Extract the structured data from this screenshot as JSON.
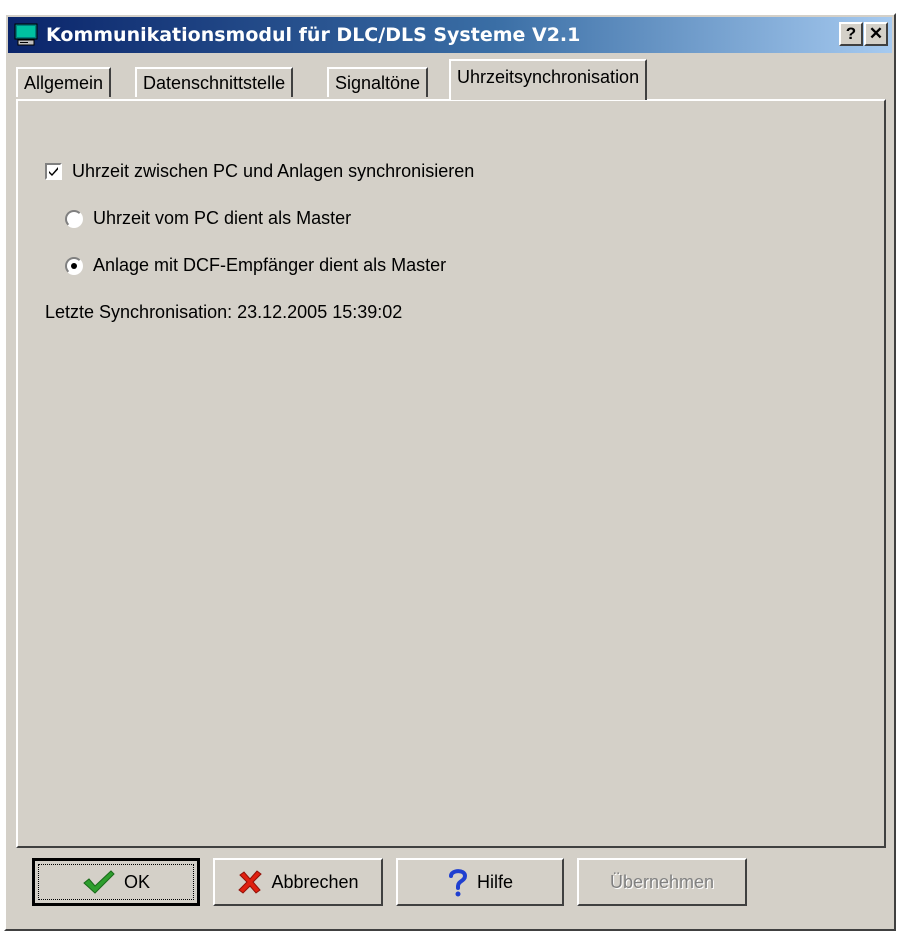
{
  "window": {
    "title": "Kommunikationsmodul für DLC/DLS Systeme V2.1",
    "help_label": "?",
    "close_label": "✕"
  },
  "tabs": [
    {
      "label": "Allgemein",
      "active": false
    },
    {
      "label": "Datenschnittstelle",
      "active": false
    },
    {
      "label": "Signaltöne",
      "active": false
    },
    {
      "label": "Uhrzeitsynchronisation",
      "active": true
    }
  ],
  "sync": {
    "checkbox_label": "Uhrzeit zwischen PC und Anlagen synchronisieren",
    "checkbox_checked": true,
    "radio_pc_label": "Uhrzeit vom PC dient als Master",
    "radio_pc_selected": false,
    "radio_dcf_label": "Anlage mit DCF-Empfänger dient als Master",
    "radio_dcf_selected": true,
    "last_sync": "Letzte Synchronisation: 23.12.2005 15:39:02"
  },
  "buttons": {
    "ok": "OK",
    "cancel": "Abbrechen",
    "help": "Hilfe",
    "apply": "Übernehmen"
  },
  "colors": {
    "face": "#d4d0c8",
    "title_start": "#0a246a",
    "title_end": "#a6caf0",
    "ok_icon": "#2e9e2e",
    "cancel_icon": "#e02010",
    "help_icon": "#1f3fd0"
  }
}
